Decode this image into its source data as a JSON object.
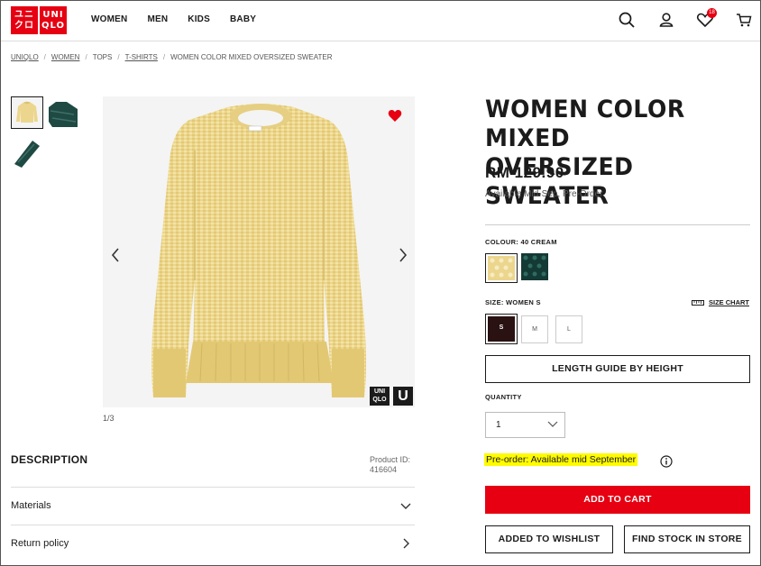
{
  "brand": {
    "logo_top_left": "ユニ",
    "logo_bottom_left": "クロ",
    "logo_top_right": "UNI",
    "logo_bottom_right": "QLO",
    "accent_color": "#e60012"
  },
  "nav": {
    "items": [
      {
        "label": "WOMEN"
      },
      {
        "label": "MEN"
      },
      {
        "label": "KIDS"
      },
      {
        "label": "BABY"
      }
    ]
  },
  "header_icons": {
    "search": "search-icon",
    "account": "user-icon",
    "wishlist": "heart-icon",
    "wishlist_count": "18",
    "cart": "cart-icon"
  },
  "breadcrumb": {
    "items": [
      "UNIQLO",
      "WOMEN",
      "TOPS",
      "T-SHIRTS",
      "WOMEN COLOR MIXED OVERSIZED SWEATER"
    ],
    "separator": "/"
  },
  "gallery": {
    "counter": "1/3",
    "badge_small": "UNI QLO",
    "badge_u": "U"
  },
  "description": {
    "title": "DESCRIPTION",
    "product_id_label": "Product ID:",
    "product_id": "416604",
    "accordions": [
      {
        "label": "Materials",
        "icon": "chevron-down-icon"
      },
      {
        "label": "Return policy",
        "icon": "chevron-right-icon"
      }
    ]
  },
  "product": {
    "title_line1": "WOMEN COLOR MIXED",
    "title_line2": "OVERSIZED SWEATER",
    "price": "RM 129.90",
    "availability": "Available Mid-Sep, Pre-Order"
  },
  "colour": {
    "label": "COLOUR: 40 CREAM"
  },
  "size": {
    "label": "SIZE: WOMEN S",
    "chart_label": "SIZE CHART",
    "options": [
      "S",
      "M",
      "L"
    ],
    "selected": "S"
  },
  "length_guide": {
    "label": "LENGTH GUIDE BY HEIGHT"
  },
  "quantity": {
    "label": "QUANTITY",
    "value": "1"
  },
  "preorder": {
    "text": "Pre-order: Available mid September"
  },
  "actions": {
    "add_to_cart": "ADD TO CART",
    "wishlist": "ADDED TO WISHLIST",
    "find_stock": "FIND STOCK IN STORE"
  }
}
